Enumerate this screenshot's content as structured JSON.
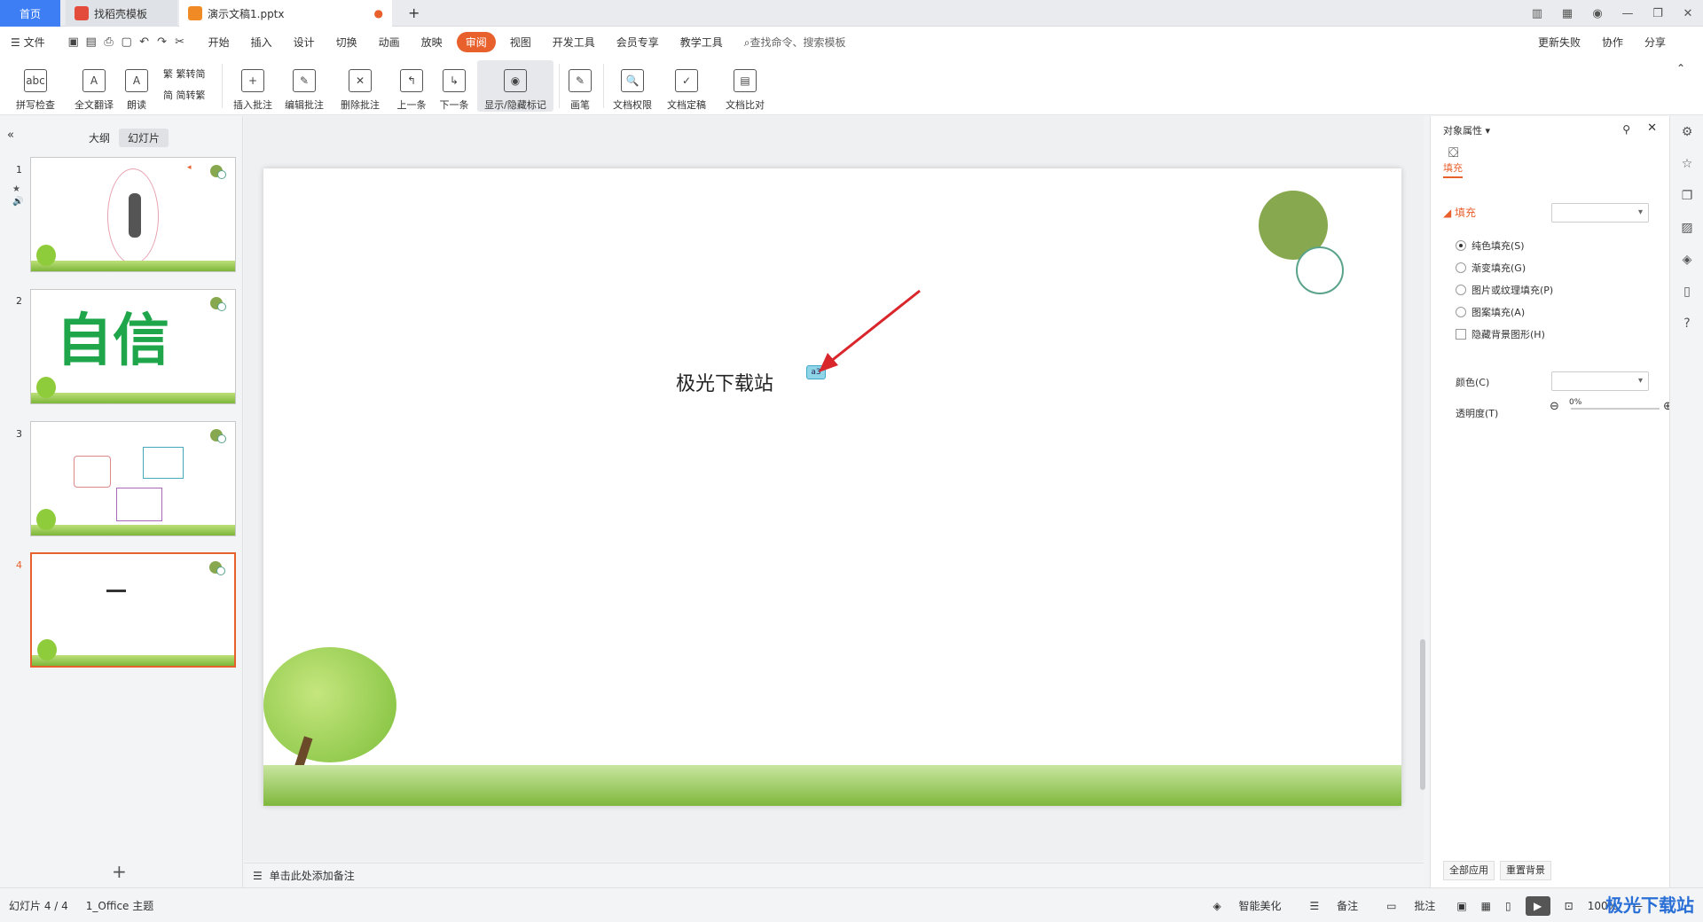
{
  "tabs": {
    "home": "首页",
    "t2": "找稻壳模板",
    "t3": "演示文稿1.pptx"
  },
  "menu": {
    "file": "文件",
    "items": [
      "开始",
      "插入",
      "设计",
      "切换",
      "动画",
      "放映",
      "审阅",
      "视图",
      "开发工具",
      "会员专享",
      "教学工具"
    ],
    "active": "审阅",
    "search": "查找命令、搜索模板",
    "update": "更新失败",
    "collab": "协作",
    "share": "分享"
  },
  "ribbon": {
    "spell": "拼写检查",
    "translate": "全文翻译",
    "read": "朗读",
    "t2s": "繁转简",
    "s2t": "简转繁",
    "insert_comment": "插入批注",
    "edit_comment": "编辑批注",
    "delete_comment": "删除批注",
    "prev": "上一条",
    "next": "下一条",
    "show_hide": "显示/隐藏标记",
    "pen": "画笔",
    "perm": "文档权限",
    "finalize": "文档定稿",
    "compare": "文档比对"
  },
  "leftpanel": {
    "outline": "大纲",
    "slides": "幻灯片",
    "nums": [
      "1",
      "2",
      "3",
      "4"
    ],
    "thumb2_text": "自信"
  },
  "slide": {
    "text": "极光下载站",
    "comment": "a3"
  },
  "notes": "单击此处添加备注",
  "rightpanel": {
    "title": "对象属性",
    "tab": "填充",
    "section": "填充",
    "opts": [
      "纯色填充(S)",
      "渐变填充(G)",
      "图片或纹理填充(P)",
      "图案填充(A)"
    ],
    "hide_bg": "隐藏背景图形(H)",
    "color": "颜色(C)",
    "transparency": "透明度(T)",
    "transparency_value": "0%",
    "apply_all": "全部应用",
    "reset_bg": "重置背景"
  },
  "status": {
    "slide": "幻灯片 4 / 4",
    "theme": "1_Office 主题",
    "beautify": "智能美化",
    "notes": "备注",
    "comments": "批注",
    "zoom": "100%"
  },
  "watermark": "极光下载站"
}
